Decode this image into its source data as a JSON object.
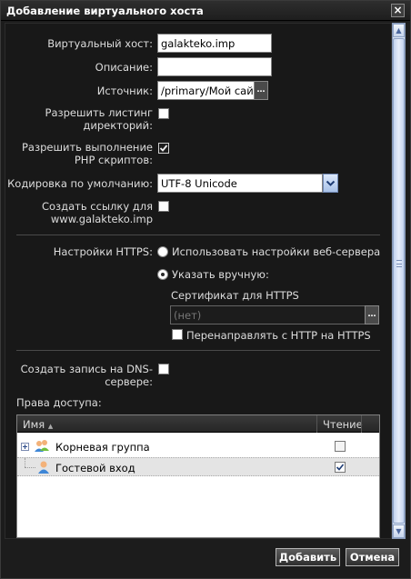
{
  "dialog": {
    "title": "Добавление виртуального хоста"
  },
  "form": {
    "vhost_label": "Виртуальный хост:",
    "vhost_value": "galakteko.imp",
    "description_label": "Описание:",
    "description_value": "",
    "source_label": "Источник:",
    "source_value": "/primary/Мой сайт",
    "dir_listing_label_1": "Разрешить листинг",
    "dir_listing_label_2": "директорий:",
    "dir_listing_checked": false,
    "php_label_1": "Разрешить выполнение",
    "php_label_2": "PHP скриптов:",
    "php_checked": true,
    "encoding_label": "Кодировка по умолчанию:",
    "encoding_value": "UTF-8 Unicode",
    "link_label_1": "Создать ссылку для",
    "link_label_2": "www.galakteko.imp",
    "link_checked": false
  },
  "https": {
    "label": "Настройки HTTPS:",
    "option_server": "Использовать настройки веб-сервера",
    "option_manual": "Указать вручную:",
    "selected": "option_manual",
    "cert_label": "Сертификат для HTTPS",
    "cert_placeholder": "(нет)",
    "redirect_label": "Перенаправлять с HTTP на HTTPS",
    "redirect_checked": false
  },
  "dns": {
    "label_1": "Создать запись на DNS-",
    "label_2": "сервере:",
    "checked": false
  },
  "access": {
    "label": "Права доступа:",
    "columns": {
      "name": "Имя",
      "read": "Чтение"
    },
    "rows": [
      {
        "name": "Корневая группа",
        "read": false
      },
      {
        "name": "Гостевой вход",
        "read": true
      }
    ]
  },
  "buttons": {
    "add": "Добавить",
    "cancel": "Отмена"
  },
  "icons": {
    "close": "close-icon",
    "browse": "ellipsis-icon",
    "dropdown": "chevron-down-icon",
    "expand": "plus-icon",
    "group": "user-group-icon",
    "user": "user-icon",
    "sort": "sort-ascending-icon"
  }
}
